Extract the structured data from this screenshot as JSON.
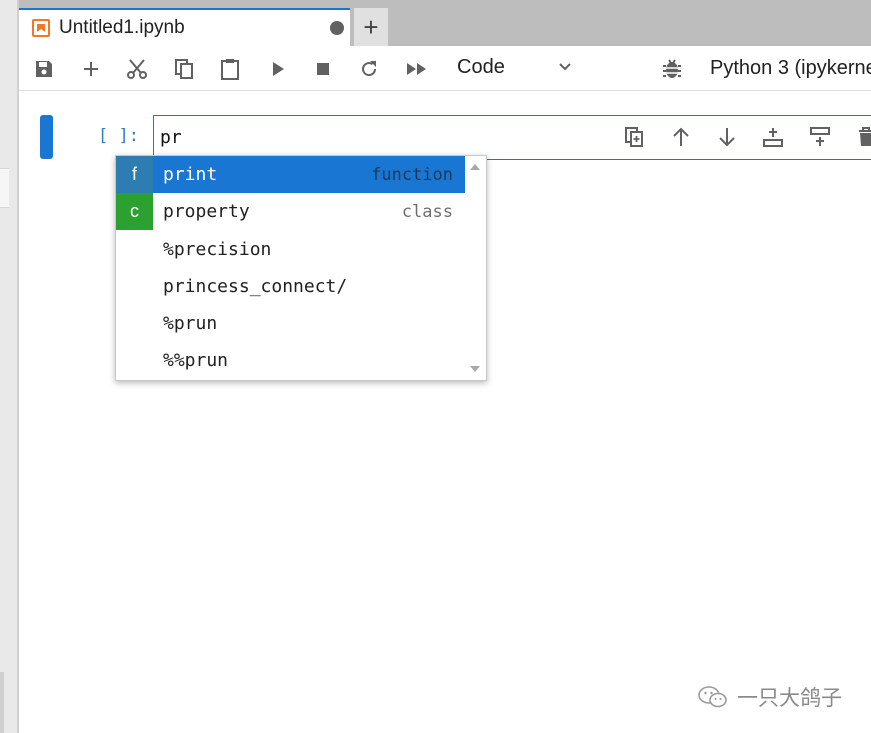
{
  "tab": {
    "title": "Untitled1.ipynb",
    "add_label": "+"
  },
  "toolbar": {
    "cell_type": "Code",
    "kernel": "Python 3 (ipykerne"
  },
  "cell": {
    "prompt": "[ ]:",
    "code": "pr"
  },
  "completer": {
    "items": [
      {
        "badge": "f",
        "badge_color": "#2d7db3",
        "label": "print",
        "type": "function",
        "active": true
      },
      {
        "badge": "c",
        "badge_color": "#2da032",
        "label": "property",
        "type": "class",
        "active": false
      },
      {
        "badge": "",
        "label": "%precision",
        "type": ""
      },
      {
        "badge": "",
        "label": "princess_connect/",
        "type": ""
      },
      {
        "badge": "",
        "label": "%prun",
        "type": ""
      },
      {
        "badge": "",
        "label": "%%prun",
        "type": ""
      }
    ]
  },
  "watermark": {
    "text": "一只大鸽子"
  },
  "colors": {
    "accent": "#1976d2",
    "prompt": "#307fc1",
    "notebook_icon": "#f37726"
  }
}
